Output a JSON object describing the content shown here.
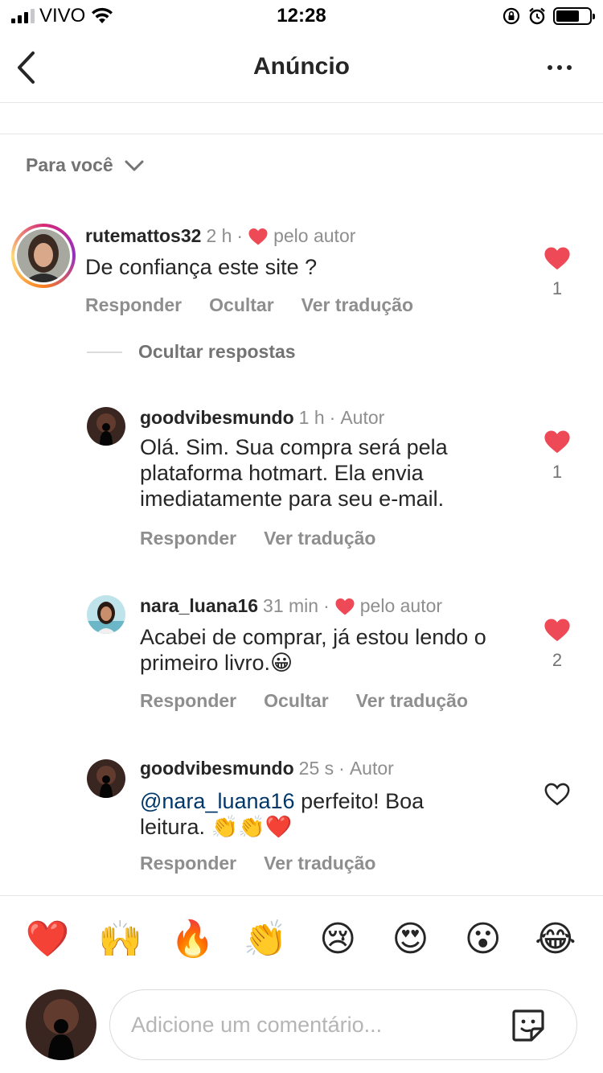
{
  "status_bar": {
    "carrier": "VIVO",
    "time": "12:28"
  },
  "nav": {
    "title": "Anúncio"
  },
  "sort": {
    "label": "Para você"
  },
  "hide_replies_label": "Ocultar respostas",
  "comments": [
    {
      "username": "rutemattos32",
      "time": "2 h",
      "tag": "pelo autor",
      "text": "De confiança este site ?",
      "actions": [
        "Responder",
        "Ocultar",
        "Ver tradução"
      ],
      "likes": "1",
      "liked": true
    },
    {
      "username": "goodvibesmundo",
      "time": "1 h",
      "tag": "Autor",
      "text": "Olá. Sim. Sua compra será pela plataforma hotmart. Ela envia imediatamente para seu e-mail.",
      "actions": [
        "Responder",
        "Ver tradução"
      ],
      "likes": "1",
      "liked": true
    },
    {
      "username": "nara_luana16",
      "time": "31 min",
      "tag": "pelo autor",
      "text": "Acabei de comprar, já estou lendo o primeiro livro.😀",
      "actions": [
        "Responder",
        "Ocultar",
        "Ver tradução"
      ],
      "likes": "2",
      "liked": true
    },
    {
      "username": "goodvibesmundo",
      "time": "25 s",
      "tag": "Autor",
      "mention": "@nara_luana16",
      "text": " perfeito! Boa leitura. 👏👏❤️",
      "actions": [
        "Responder",
        "Ver tradução"
      ],
      "liked": false
    }
  ],
  "quick_reactions": [
    "❤️",
    "🙌",
    "🔥",
    "👏",
    "😢",
    "😍",
    "😮",
    "😂"
  ],
  "composer": {
    "placeholder": "Adicione um comentário..."
  },
  "colors": {
    "like_red": "#ed4956",
    "mention_blue": "#00376b",
    "secondary_text": "#8e8e8e"
  },
  "icons": [
    "back-arrow-icon",
    "more-options-icon",
    "chevron-down-icon",
    "heart-icon",
    "heart-outline-icon",
    "sticker-icon"
  ]
}
